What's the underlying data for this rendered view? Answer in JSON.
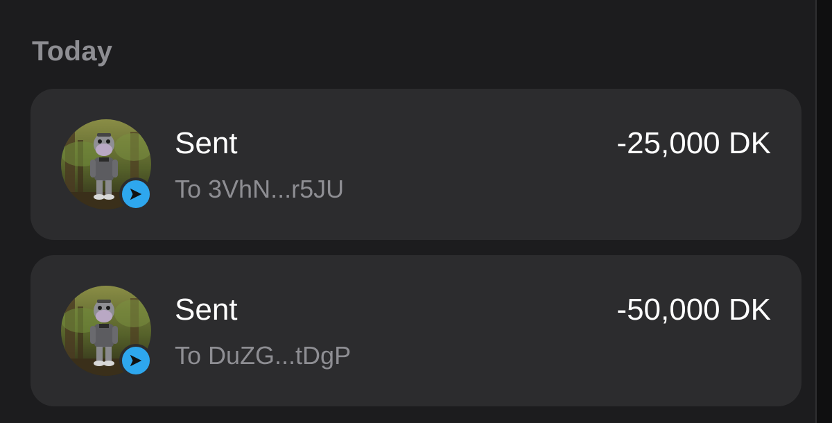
{
  "colors": {
    "background": "#1c1c1e",
    "card": "#2c2c2e",
    "primary_text": "#ffffff",
    "secondary_text": "#8e8e93",
    "badge_accent": "#2ea7ee"
  },
  "section": {
    "title": "Today"
  },
  "transactions": [
    {
      "title": "Sent",
      "recipient": "To 3VhN...r5JU",
      "amount": "-25,000 DK",
      "avatar_icon": "cartoon-character-avatar",
      "badge_icon": "send-arrow-icon"
    },
    {
      "title": "Sent",
      "recipient": "To DuZG...tDgP",
      "amount": "-50,000 DK",
      "avatar_icon": "cartoon-character-avatar",
      "badge_icon": "send-arrow-icon"
    }
  ]
}
